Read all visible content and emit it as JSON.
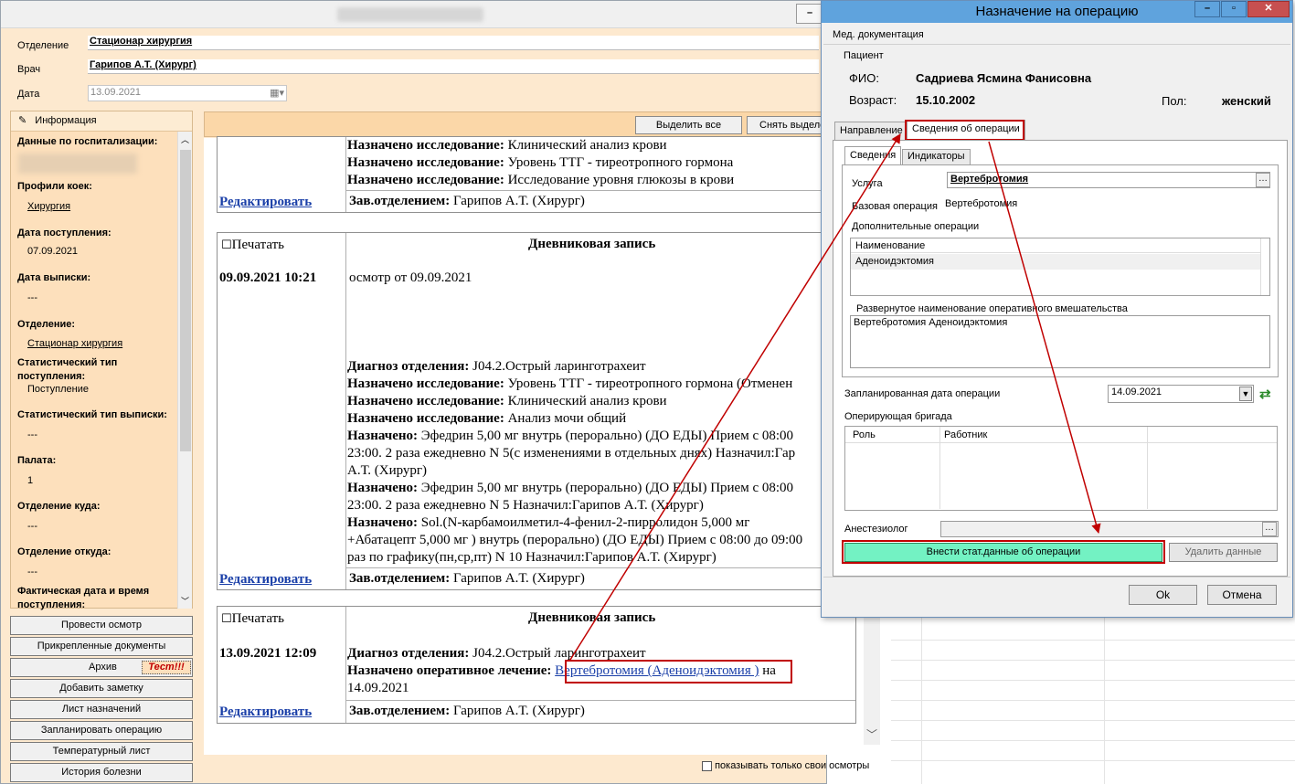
{
  "main": {
    "header": {
      "department_label": "Отделение",
      "department_value": "Стационар  хирургия",
      "doctor_label": "Врач",
      "doctor_value": "Гарипов А.Т. (Хирург)",
      "date_label": "Дата",
      "date_value": "13.09.2021"
    },
    "info_panel": {
      "title": "Информация",
      "hospitalization_label": "Данные по госпитализации:",
      "bed_profiles_label": "Профили коек:",
      "bed_profiles_value": "Хирургия",
      "admission_date_label": "Дата поступления:",
      "admission_date_value": "07.09.2021",
      "discharge_date_label": "Дата выписки:",
      "discharge_date_value": "---",
      "department_label": "Отделение:",
      "department_value": "Стационар  хирургия",
      "stat_admission_label1": "Статистический тип",
      "stat_admission_label2": "поступления:",
      "stat_admission_value": "Поступление",
      "stat_discharge_label": "Статистический тип выписки:",
      "stat_discharge_value": "---",
      "ward_label": "Палата:",
      "ward_value": "1",
      "dept_to_label": "Отделение куда:",
      "dept_to_value": "---",
      "dept_from_label": "Отделение откуда:",
      "dept_from_value": "---",
      "actual_date_label1": "Фактическая дата и время",
      "actual_date_label2": "поступления:"
    },
    "buttons": [
      "Провести осмотр",
      "Прикрепленные документы",
      "Архив",
      "Добавить заметку",
      "Лист назначений",
      "Запланировать операцию",
      "Температурный лист",
      "История болезни"
    ],
    "archive_badge": "Тест!!!",
    "toolbar": {
      "select_all": "Выделить все",
      "deselect": "Снять выделе"
    },
    "entry0": {
      "lines": [
        {
          "b": "Назначено исследование:",
          "t": " Клинический анализ крови"
        },
        {
          "b": "Назначено исследование:",
          "t": " Уровень ТТГ - тиреотропного гормона"
        },
        {
          "b": "Назначено исследование:",
          "t": " Исследование уровня глюкозы в крови"
        }
      ],
      "edit": "Редактировать",
      "head_b": "Зав.отделением:",
      "head_t": " Гарипов А.Т. (Хирург)"
    },
    "entry1": {
      "print": "Печатать",
      "title": "Дневниковая запись",
      "datetime": "09.09.2021 10:21",
      "exam": "осмотр от 09.09.2021",
      "lines": [
        {
          "b": "Диагноз отделения:",
          "t": " J04.2.Острый ларинготрахеит"
        },
        {
          "b": "Назначено исследование:",
          "t": " Уровень ТТГ - тиреотропного гормона (Отменен"
        },
        {
          "b": "Назначено исследование:",
          "t": " Клинический анализ крови"
        },
        {
          "b": "Назначено исследование:",
          "t": " Анализ мочи общий"
        },
        {
          "b": "Назначено:",
          "t": " Эфедрин 5,00 мг внутрь (перорально) (ДО ЕДЫ) Прием с 08:00"
        },
        {
          "b": "",
          "t": "23:00. 2 раза ежедневно N 5(с изменениями в отдельных днях) Назначил:Гар"
        },
        {
          "b": "",
          "t": "А.Т. (Хирург)"
        },
        {
          "b": "Назначено:",
          "t": " Эфедрин 5,00 мг внутрь (перорально) (ДО ЕДЫ) Прием с 08:00"
        },
        {
          "b": "",
          "t": "23:00. 2 раза ежедневно N 5 Назначил:Гарипов А.Т. (Хирург)"
        },
        {
          "b": "Назначено:",
          "t": " Sol.(N-карбамоилметил-4-фенил-2-пирролидон 5,000 мг"
        },
        {
          "b": "",
          "t": "+Абатацепт 5,000 мг ) внутрь (перорально) (ДО ЕДЫ) Прием с 08:00 до 09:00"
        },
        {
          "b": "",
          "t": "раз по графику(пн,ср,пт) N 10 Назначил:Гарипов А.Т. (Хирург)"
        }
      ],
      "edit": "Редактировать",
      "head_b": "Зав.отделением:",
      "head_t": " Гарипов А.Т. (Хирург)"
    },
    "entry2": {
      "print": "Печатать",
      "title": "Дневниковая запись",
      "datetime": "13.09.2021 12:09",
      "diag_b": "Диагноз отделения:",
      "diag_t": " J04.2.Острый ларинготрахеит",
      "op_b": "Назначено оперативное лечение:",
      "op_link": "Вертебротомия (Аденоидэктомия )",
      "op_tail": " на",
      "op_date": "14.09.2021",
      "edit": "Редактировать",
      "head_b": "Зав.отделением:",
      "head_t": " Гарипов А.Т. (Хирург)"
    },
    "only_own": "показывать только свои осмотры"
  },
  "dialog": {
    "title": "Назначение на операцию",
    "menu": "Мед. документация",
    "patient_group": "Пациент",
    "fio_label": "ФИО:",
    "fio_value": "Садриева Ясмина Фанисовна",
    "age_label": "Возраст:",
    "age_value": "15.10.2002",
    "sex_label": "Пол:",
    "sex_value": "женский",
    "tabs": [
      "Направление",
      "Сведения об операции"
    ],
    "subtabs": [
      "Сведения",
      "Индикаторы"
    ],
    "service_label": "Услуга",
    "service_value": "Вертебротомия",
    "base_op_label": "Базовая операция",
    "base_op_value": "Вертебротомия",
    "extra_ops_label": "Дополнительные операции",
    "extra_ops_header": "Наименование",
    "extra_ops_rows": [
      "Аденоидэктомия"
    ],
    "full_name_label": "Развернутое наименование оперативного вмешательства",
    "full_name_value": "Вертебротомия Аденоидэктомия",
    "planned_date_label": "Запланированная дата операции",
    "planned_date_value": "14.09.2021",
    "team_label": "Оперирующая бригада",
    "team_cols": [
      "Роль",
      "Работник"
    ],
    "anesth_label": "Анестезиолог",
    "stat_button": "Внести стат.данные об операции",
    "delete_button": "Удалить данные",
    "ok": "Ok",
    "cancel": "Отмена"
  },
  "colors": {
    "accent_red": "#c00000",
    "green_button": "#73f2c3",
    "title_blue": "#5fa3dd"
  }
}
